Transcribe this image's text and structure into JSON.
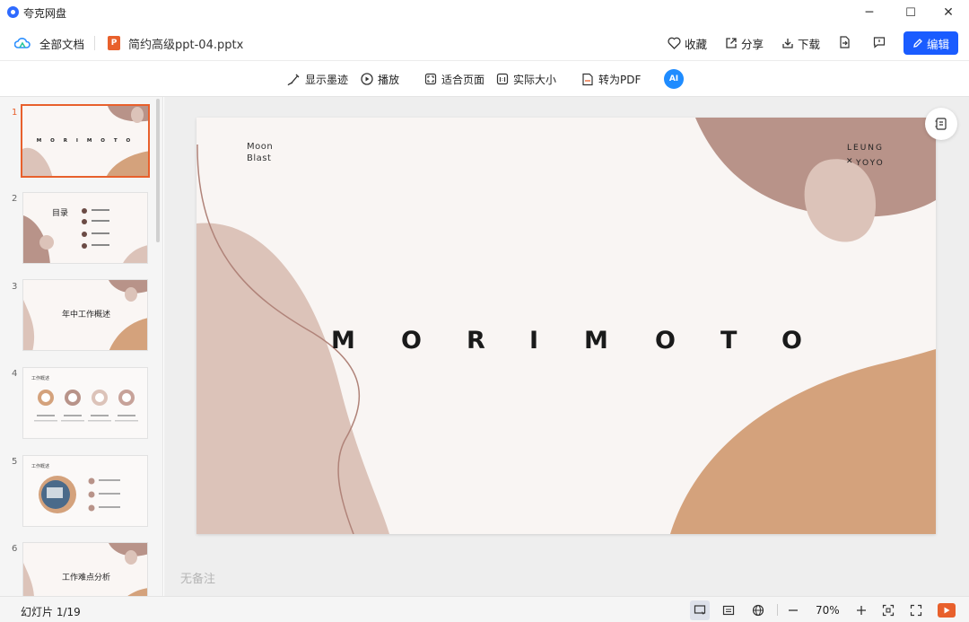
{
  "window": {
    "title": "夸克网盘",
    "minimize": "─",
    "maximize": "☐",
    "close": "✕"
  },
  "toolbar": {
    "all_docs": "全部文档",
    "file_name": "简约高级ppt-04.pptx",
    "file_badge": "P",
    "favorite": "收藏",
    "share": "分享",
    "download": "下载",
    "edit": "编辑"
  },
  "viewbar": {
    "show_ink": "显示墨迹",
    "play": "播放",
    "fit_page": "适合页面",
    "actual_size": "实际大小",
    "to_pdf": "转为PDF",
    "ai": "AI"
  },
  "thumbnails": [
    {
      "num": "1",
      "title": "M O R I M O T O"
    },
    {
      "num": "2",
      "title": "目录"
    },
    {
      "num": "3",
      "title": "年中工作概述"
    },
    {
      "num": "4",
      "title": "工作概述"
    },
    {
      "num": "5",
      "title": "工作概述"
    },
    {
      "num": "6",
      "title": "工作难点分析"
    }
  ],
  "slide": {
    "moon": "Moon",
    "blast": "Blast",
    "leung": "LEUNG",
    "yoyo": "YOYO",
    "x_mark": "✕",
    "title_letters": [
      "M",
      "O",
      "R",
      "I",
      "M",
      "O",
      "T",
      "O"
    ]
  },
  "notes": "无备注",
  "status": {
    "slide_counter": "幻灯片 1/19",
    "zoom": "70%"
  },
  "colors": {
    "accent": "#1a5cff",
    "ppt": "#e8602c",
    "brown": "#b89389",
    "peach": "#d4a27c",
    "blush": "#dcc3b9"
  }
}
